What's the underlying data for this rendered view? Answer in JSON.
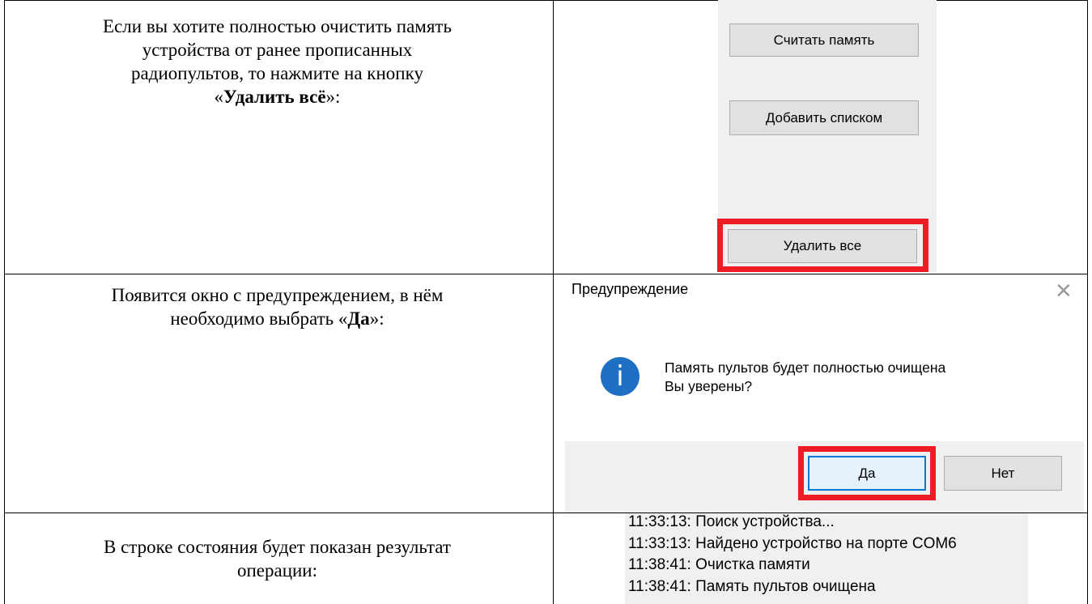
{
  "rows": [
    {
      "instruction_lines": [
        "Если вы хотите полностью очистить память",
        "устройства от ранее прописанных",
        "радиопультов, то нажмите на кнопку"
      ],
      "instruction_last_prefix": "«",
      "instruction_bold": "Удалить всё",
      "instruction_last_suffix": "»:"
    },
    {
      "instruction_lines": [
        "Появится окно с предупреждением, в нём"
      ],
      "instruction_last_prefix": "необходимо выбрать «",
      "instruction_bold": "Да",
      "instruction_last_suffix": "»:"
    },
    {
      "instruction_lines": [
        "В строке состояния будет показан результат",
        "операции:"
      ]
    }
  ],
  "memory_panel": {
    "read_button": "Считать память",
    "add_list_button": "Добавить списком",
    "delete_all_button": "Удалить все"
  },
  "warning_dialog": {
    "title": "Предупреждение",
    "close_glyph": "✕",
    "icon_glyph": "i",
    "message_line1": "Память пультов будет полностью очищена",
    "message_line2": "Вы уверены?",
    "yes_button": "Да",
    "no_button": "Нет"
  },
  "status_log": [
    "11:33:13: Поиск устройства...",
    "11:33:13: Найдено устройство на порте COM6",
    "11:38:41: Очистка памяти",
    "11:38:41: Память пультов очищена"
  ],
  "colors": {
    "highlight": "#ee1c24",
    "info_icon": "#1f6fc5",
    "button_face": "#e1e1e1",
    "panel_bg": "#f0f0f0"
  },
  "icons": [
    "info-icon",
    "close-icon"
  ]
}
